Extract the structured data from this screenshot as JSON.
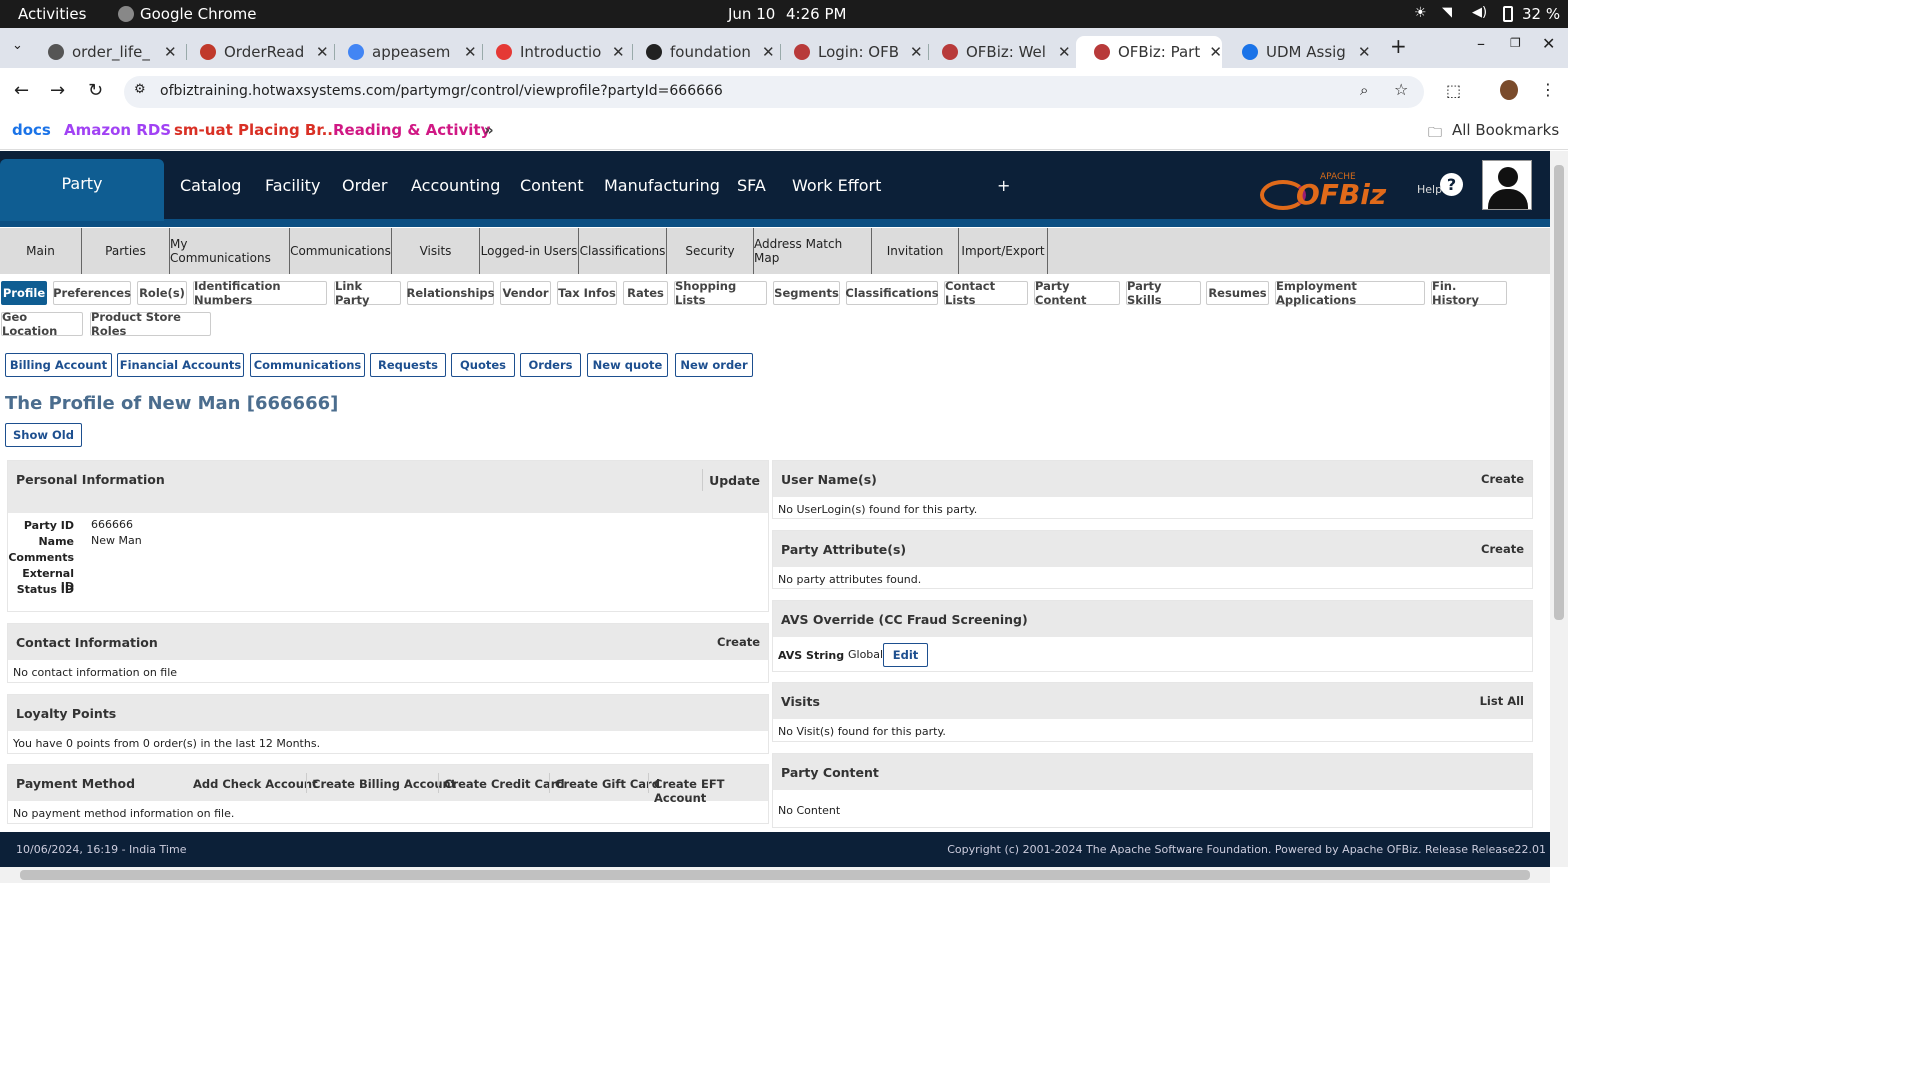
{
  "os": {
    "activities": "Activities",
    "app": "Google Chrome",
    "date": "Jun 10",
    "time": "4:26 PM",
    "battery": "32 %"
  },
  "tabs": [
    {
      "title": "order_life_",
      "color": "#555"
    },
    {
      "title": "OrderRead",
      "color": "#c0392b"
    },
    {
      "title": "appeasem",
      "color": "#4285f4"
    },
    {
      "title": "Introductio",
      "color": "#e53935"
    },
    {
      "title": "foundation",
      "color": "#222"
    },
    {
      "title": "Login: OFB",
      "color": "#b83a3a"
    },
    {
      "title": "OFBiz: Wel",
      "color": "#b83a3a"
    },
    {
      "title": "OFBiz: Part",
      "color": "#b83a3a"
    },
    {
      "title": "UDM Assig",
      "color": "#1a73e8"
    }
  ],
  "url": "ofbiztraining.hotwaxsystems.com/partymgr/control/viewprofile?partyId=666666",
  "bookmarks": [
    {
      "label": "docs",
      "color": "#1a73e8"
    },
    {
      "label": "Amazon RDS",
      "color": "#a142f4"
    },
    {
      "label": "sm-uat Placing Br...",
      "color": "#d93025"
    },
    {
      "label": "Reading & Activity",
      "color": "#d01884"
    }
  ],
  "all_bookmarks": "All Bookmarks",
  "app": {
    "active_tab": "Party",
    "menu": [
      "Catalog",
      "Facility",
      "Order",
      "Accounting",
      "Content",
      "Manufacturing",
      "SFA",
      "Work Effort",
      "+"
    ],
    "help": "Help",
    "logo_small": "APACHE",
    "logo": "OFBiz"
  },
  "submenu": [
    "Main",
    "Parties",
    "My Communications",
    "Communications",
    "Visits",
    "Logged-in Users",
    "Classifications",
    "Security",
    "Address Match Map",
    "Invitation",
    "Import/Export"
  ],
  "profile_tabs": [
    "Profile",
    "Preferences",
    "Role(s)",
    "Identification Numbers",
    "Link Party",
    "Relationships",
    "Vendor",
    "Tax Infos",
    "Rates",
    "Shopping Lists",
    "Segments",
    "Classifications",
    "Contact Lists",
    "Party Content",
    "Party Skills",
    "Resumes",
    "Employment Applications",
    "Fin. History",
    "Geo Location",
    "Product Store Roles"
  ],
  "action_buttons": [
    "Billing Account",
    "Financial Accounts",
    "Communications",
    "Requests",
    "Quotes",
    "Orders",
    "New quote",
    "New order"
  ],
  "page_title": "The Profile of New Man [666666]",
  "show_old": "Show Old",
  "personal": {
    "title": "Personal Information",
    "update": "Update",
    "fields": [
      {
        "label": "Party ID",
        "value": "666666"
      },
      {
        "label": "Name",
        "value": "New Man"
      },
      {
        "label": "Comments",
        "value": ""
      },
      {
        "label": "External ID",
        "value": ""
      },
      {
        "label": "Status ID",
        "value": ""
      }
    ]
  },
  "contact": {
    "title": "Contact Information",
    "create": "Create",
    "body": "No contact information on file"
  },
  "loyalty": {
    "title": "Loyalty Points",
    "body": "You have 0 points from 0 order(s) in the last 12 Months."
  },
  "payment": {
    "title": "Payment Method",
    "links": [
      "Add Check Account",
      "Create Billing Account",
      "Create Credit Card",
      "Create Gift Card",
      "Create EFT Account"
    ],
    "body": "No payment method information on file."
  },
  "usernames": {
    "title": "User Name(s)",
    "create": "Create",
    "body": "No UserLogin(s) found for this party."
  },
  "attributes": {
    "title": "Party Attribute(s)",
    "create": "Create",
    "body": "No party attributes found."
  },
  "avs": {
    "title": "AVS Override (CC Fraud Screening)",
    "label": "AVS String",
    "value": "Global",
    "edit": "Edit"
  },
  "visits": {
    "title": "Visits",
    "list_all": "List All",
    "body": "No Visit(s) found for this party."
  },
  "party_content": {
    "title": "Party Content",
    "body": "No Content"
  },
  "footer": {
    "left": "10/06/2024, 16:19 - India Time",
    "right": "Copyright (c) 2001-2024 The Apache Software Foundation. Powered by Apache OFBiz. Release Release22.01"
  }
}
